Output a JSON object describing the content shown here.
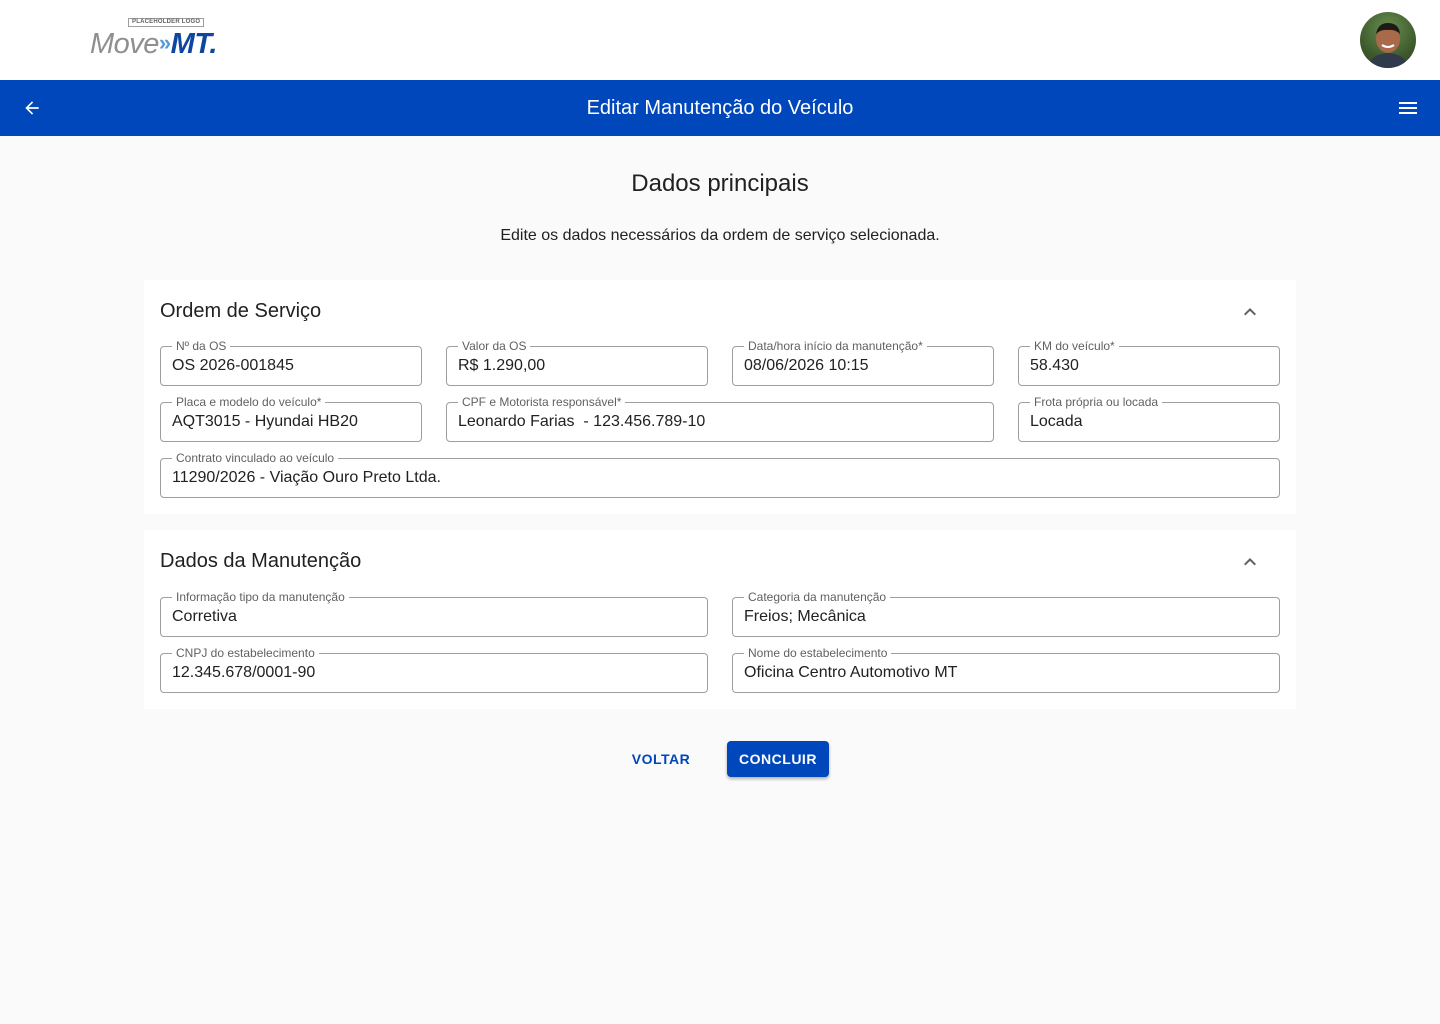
{
  "header": {
    "logo_tag": "PLACEHOLDER LOGO",
    "logo_move": "Move",
    "logo_arrows": "»",
    "logo_mt": "MT.",
    "avatar_icon": "user-avatar-photo"
  },
  "appbar": {
    "title": "Editar Manutenção do Veículo",
    "back_icon": "arrow-left-icon",
    "menu_icon": "menu-icon",
    "color": "#0047bb"
  },
  "page": {
    "heading": "Dados principais",
    "subtitle": "Edite os dados necessários da ordem de serviço selecionada."
  },
  "ordem_servico": {
    "title": "Ordem de Serviço",
    "fields": [
      {
        "label": "Nº da OS",
        "value": "OS 2026-001845"
      },
      {
        "label": "Valor da OS",
        "value": "R$ 1.290,00"
      },
      {
        "label": "Data/hora início da manutenção*",
        "value": "08/06/2026 10:15"
      },
      {
        "label": "KM do veículo*",
        "value": "58.430"
      },
      {
        "label": "Placa e modelo do veículo*",
        "value": "AQT3015 - Hyundai HB20"
      },
      {
        "label": "CPF e Motorista responsável*",
        "value": "Leonardo Farias  - 123.456.789-10"
      },
      {
        "label": "Frota própria ou locada",
        "value": "Locada"
      },
      {
        "label": "Contrato vinculado ao veículo",
        "value": "11290/2026 - Viação Ouro Preto Ltda."
      }
    ]
  },
  "dados_manutencao": {
    "title": "Dados da Manutenção",
    "fields": [
      {
        "label": "Informação tipo da manutenção",
        "value": "Corretiva"
      },
      {
        "label": "Categoria da manutenção",
        "value": "Freios; Mecânica"
      },
      {
        "label": "CNPJ do estabelecimento",
        "value": "12.345.678/0001-90"
      },
      {
        "label": "Nome do estabelecimento",
        "value": "Oficina Centro Automotivo MT"
      }
    ]
  },
  "actions": {
    "back_label": "VOLTAR",
    "submit_label": "CONCLUIR"
  }
}
